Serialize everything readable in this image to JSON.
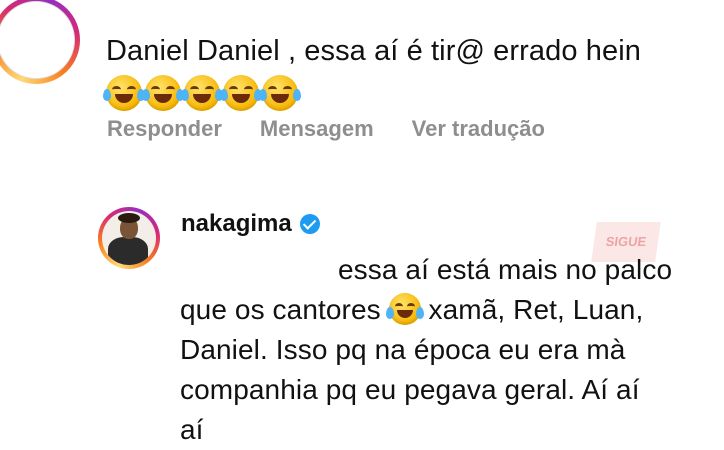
{
  "comment": {
    "text": "Daniel Daniel , essa aí é tir@ errado hein",
    "emoji": [
      "tears-of-joy-emoji",
      "tears-of-joy-emoji",
      "tears-of-joy-emoji",
      "tears-of-joy-emoji",
      "tears-of-joy-emoji"
    ]
  },
  "actions": {
    "reply": "Responder",
    "message": "Mensagem",
    "translate": "Ver tradução"
  },
  "reply": {
    "username": "nakagima",
    "verified_icon": "verified-badge-icon",
    "line1": "essa aí está mais no palco",
    "line2a": "que os cantores",
    "line2b": "xamã, Ret, Luan,",
    "line3": "Daniel. Isso pq na época eu era mà",
    "line4": "companhia pq eu pegava geral. Aí aí",
    "line5": "aí"
  },
  "watermark": "SIGUE",
  "colors": {
    "action_gray": "#8e8e8e",
    "verified_blue": "#1d9bf0"
  }
}
